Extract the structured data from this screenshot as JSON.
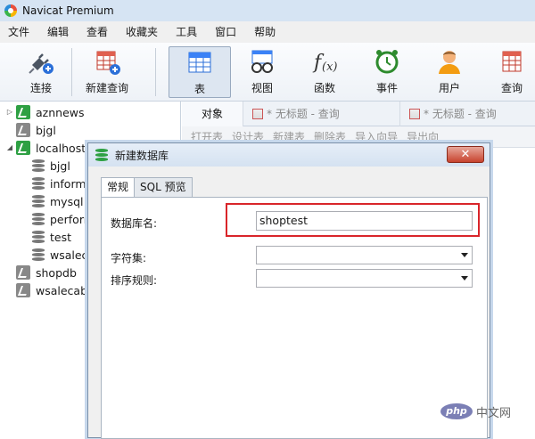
{
  "window": {
    "title": "Navicat Premium"
  },
  "menu": [
    "文件",
    "编辑",
    "查看",
    "收藏夹",
    "工具",
    "窗口",
    "帮助"
  ],
  "toolbar": {
    "buttons": [
      {
        "label": "连接",
        "icon": "plug-add-icon"
      },
      {
        "label": "新建查询",
        "icon": "new-query-icon"
      },
      {
        "label": "表",
        "icon": "table-icon"
      },
      {
        "label": "视图",
        "icon": "view-icon"
      },
      {
        "label": "函数",
        "icon": "function-icon"
      },
      {
        "label": "事件",
        "icon": "clock-event-icon"
      },
      {
        "label": "用户",
        "icon": "user-icon"
      },
      {
        "label": "查询",
        "icon": "query-icon"
      }
    ]
  },
  "tree": {
    "connections": [
      {
        "name": "aznnews",
        "expanded": false
      },
      {
        "name": "bjgl",
        "expanded": false
      },
      {
        "name": "localhost_",
        "expanded": true
      },
      {
        "name": "shopdb",
        "expanded": false
      },
      {
        "name": "wsalecabi",
        "expanded": false
      }
    ],
    "databases": [
      "bjgl",
      "informa",
      "mysql",
      "perforr",
      "test",
      "wsaleca"
    ]
  },
  "tabs": {
    "objects": "对象",
    "query1": "* 无标题 - 查询",
    "query2": "* 无标题 - 查询"
  },
  "subtoolbar": [
    "打开表",
    "设计表",
    "新建表",
    "删除表",
    "导入向导",
    "导出向"
  ],
  "dialog": {
    "title": "新建数据库",
    "close_label": "✕",
    "tabs": [
      "常规",
      "SQL 预览"
    ],
    "fields": {
      "db_name_label": "数据库名:",
      "db_name_value": "shoptest",
      "charset_label": "字符集:",
      "charset_value": "",
      "collation_label": "排序规则:",
      "collation_value": ""
    }
  },
  "colors": {
    "highlight": "#d9252a",
    "accent": "#2ea043"
  },
  "watermark": {
    "logo": "php",
    "text": "中文网"
  }
}
